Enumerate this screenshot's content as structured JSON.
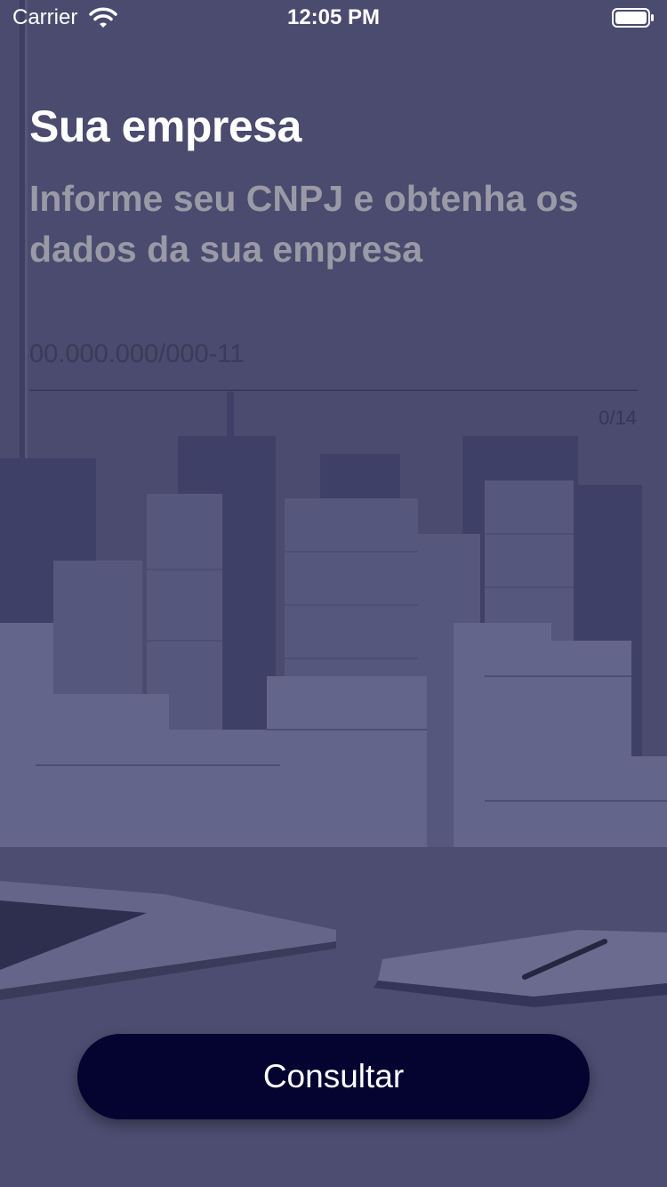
{
  "status_bar": {
    "carrier": "Carrier",
    "time": "12:05 PM"
  },
  "main": {
    "title": "Sua empresa",
    "subtitle": "Informe seu CNPJ e obtenha os dados da sua empresa",
    "cnpj_input": {
      "placeholder": "00.000.000/000-11",
      "value": "",
      "counter": "0/14"
    },
    "consult_button_label": "Consultar"
  },
  "colors": {
    "overlay": "#4a4b6e",
    "button": "#050431",
    "title": "#ffffff",
    "subtitle": "#9a9aa6"
  },
  "icons": {
    "wifi": "wifi-icon",
    "battery": "battery-icon"
  }
}
